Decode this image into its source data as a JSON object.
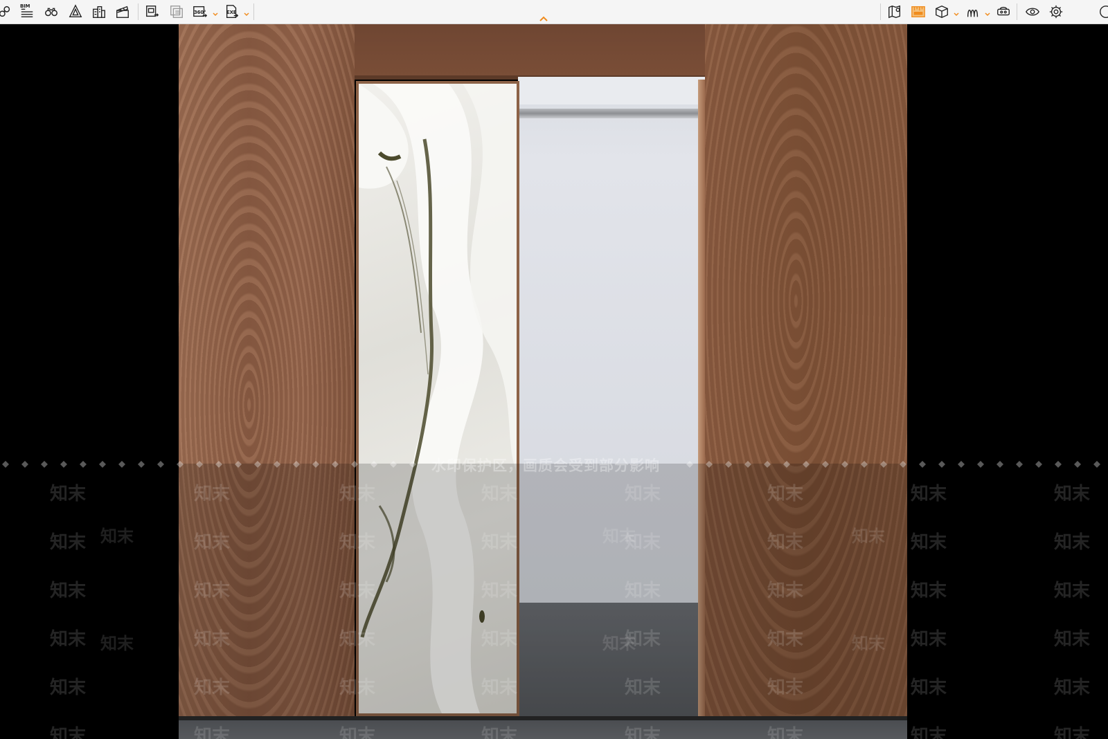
{
  "toolbar": {
    "left_tools": [
      {
        "id": "link",
        "icon": "link-icon"
      },
      {
        "id": "bim",
        "icon": "bim-list-icon",
        "badge": "BIM"
      },
      {
        "id": "walkthrough",
        "icon": "binoculars-icon"
      },
      {
        "id": "perspective",
        "icon": "prism-view-icon"
      },
      {
        "id": "buildings",
        "icon": "buildings-icon"
      },
      {
        "id": "animation",
        "icon": "clapperboard-icon"
      },
      {
        "id": "render-image",
        "icon": "image-export-icon"
      },
      {
        "id": "batch-render",
        "icon": "batch-image-icon"
      },
      {
        "id": "panorama",
        "icon": "panorama-export-icon",
        "badge": "360°"
      },
      {
        "id": "exe-export",
        "icon": "exe-export-icon",
        "badge": "EXE"
      }
    ],
    "right_tools": [
      {
        "id": "map",
        "icon": "map-pin-icon"
      },
      {
        "id": "ruler",
        "icon": "ruler-highlight-icon",
        "active": true
      },
      {
        "id": "cube",
        "icon": "cube-icon"
      },
      {
        "id": "path",
        "icon": "path-icon"
      },
      {
        "id": "vr",
        "icon": "vr-headset-icon"
      },
      {
        "id": "visibility",
        "icon": "eye-icon"
      },
      {
        "id": "settings",
        "icon": "gear-icon"
      },
      {
        "id": "help",
        "icon": "help-icon"
      }
    ],
    "accent_color": "#f08c1e"
  },
  "watermark": {
    "notice": "水印保护区，画质会受到部分影响",
    "brand": "知末"
  }
}
